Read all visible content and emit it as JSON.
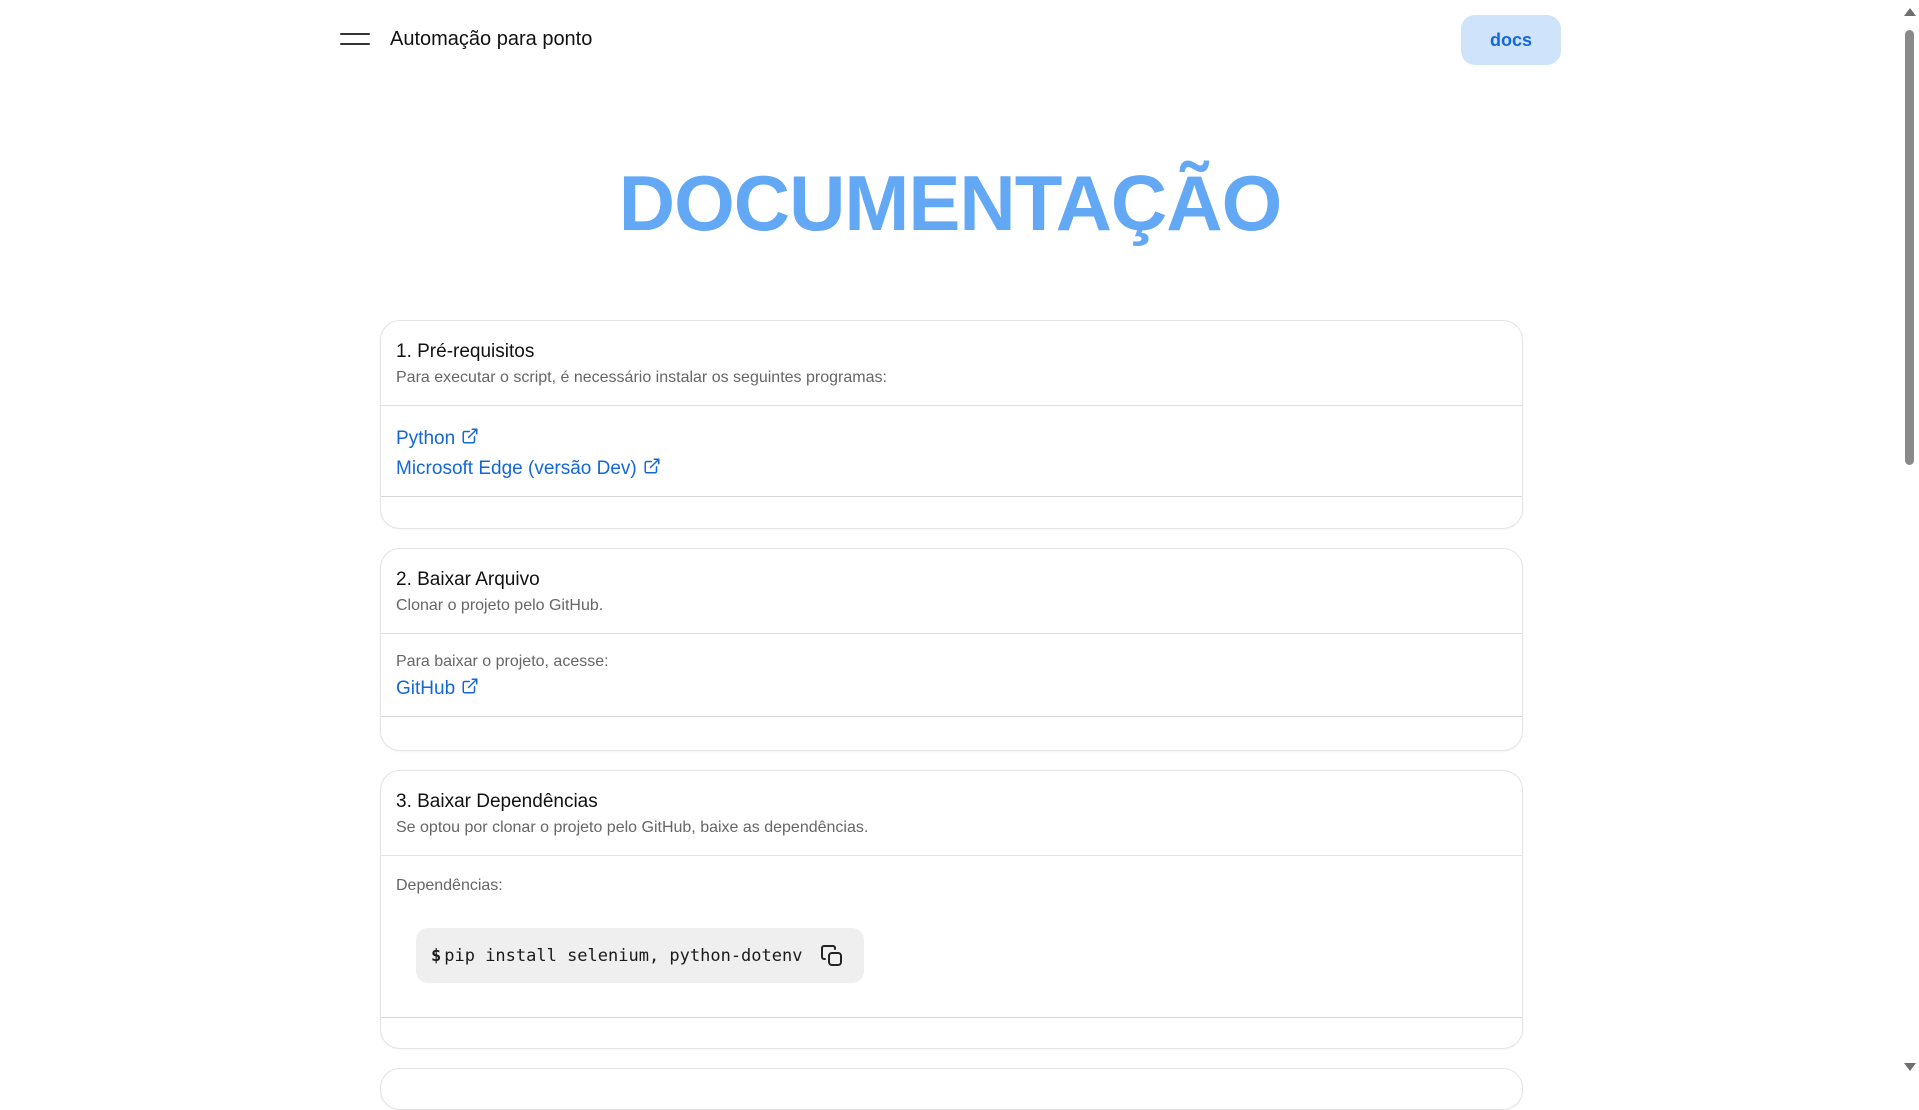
{
  "header": {
    "app_title": "Automação para ponto",
    "docs_label": "docs",
    "menu_icon": "hamburger-menu-icon"
  },
  "page": {
    "title": "DOCUMENTAÇÃO"
  },
  "sections": [
    {
      "title": "1. Pré-requisitos",
      "subtitle": "Para executar o script, é necessário instalar os seguintes programas:",
      "links": [
        {
          "label": "Python",
          "icon": "external-link-icon"
        },
        {
          "label": "Microsoft Edge (versão Dev)",
          "icon": "external-link-icon"
        }
      ]
    },
    {
      "title": "2. Baixar Arquivo",
      "subtitle": "Clonar o projeto pelo GitHub.",
      "text": "Para baixar o projeto, acesse:",
      "links": [
        {
          "label": "GitHub",
          "icon": "external-link-icon"
        }
      ]
    },
    {
      "title": "3. Baixar Dependências",
      "subtitle": "Se optou por clonar o projeto pelo GitHub, baixe as dependências.",
      "text": "Dependências:",
      "code": {
        "prompt": "$",
        "command": "pip install selenium, python-dotenv",
        "copy_icon": "copy-icon"
      }
    }
  ],
  "colors": {
    "accent": "#1467d8",
    "title": "#62a8f5",
    "docs_bg": "#cfe3fb",
    "code_bg": "#efefef"
  }
}
